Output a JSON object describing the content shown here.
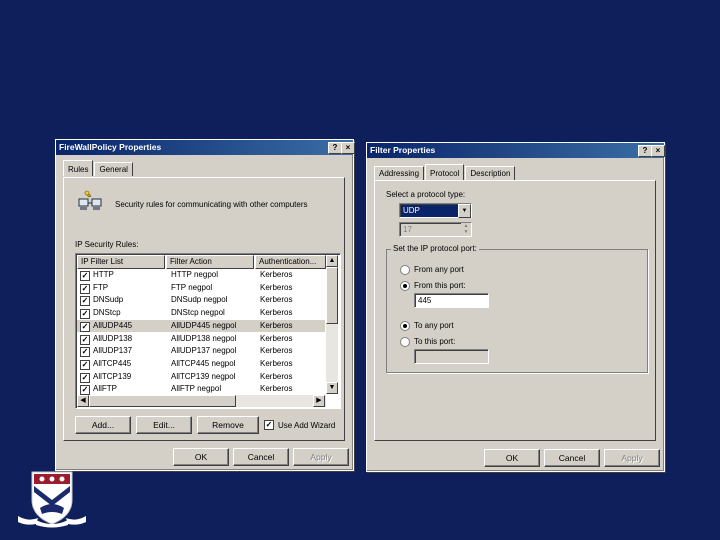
{
  "left_dialog": {
    "title": "FireWallPolicy Properties",
    "help": "?",
    "close": "×",
    "tabs": [
      "Rules",
      "General"
    ],
    "description": "Security rules for communicating with other computers",
    "rules_label": "IP Security Rules:",
    "columns": [
      "IP Filter List",
      "Filter Action",
      "Authentication..."
    ],
    "rows": [
      {
        "checked": true,
        "filter": "HTTP",
        "action": "HTTP negpol",
        "auth": "Kerberos"
      },
      {
        "checked": true,
        "filter": "FTP",
        "action": "FTP negpol",
        "auth": "Kerberos"
      },
      {
        "checked": true,
        "filter": "DNSudp",
        "action": "DNSudp negpol",
        "auth": "Kerberos"
      },
      {
        "checked": true,
        "filter": "DNStcp",
        "action": "DNStcp negpol",
        "auth": "Kerberos"
      },
      {
        "checked": true,
        "filter": "AllUDP445",
        "action": "AllUDP445 negpol",
        "auth": "Kerberos",
        "selected": true
      },
      {
        "checked": true,
        "filter": "AllUDP138",
        "action": "AllUDP138 negpol",
        "auth": "Kerberos"
      },
      {
        "checked": true,
        "filter": "AllUDP137",
        "action": "AllUDP137 negpol",
        "auth": "Kerberos"
      },
      {
        "checked": true,
        "filter": "AllTCP445",
        "action": "AllTCP445 negpol",
        "auth": "Kerberos"
      },
      {
        "checked": true,
        "filter": "AllTCP139",
        "action": "AllTCP139 negpol",
        "auth": "Kerberos"
      },
      {
        "checked": true,
        "filter": "AllFTP",
        "action": "AllFTP negpol",
        "auth": "Kerberos"
      }
    ],
    "buttons": {
      "add": "Add...",
      "edit": "Edit...",
      "remove": "Remove"
    },
    "use_wizard": "Use Add Wizard",
    "footer": {
      "ok": "OK",
      "cancel": "Cancel",
      "apply": "Apply"
    }
  },
  "right_dialog": {
    "title": "Filter Properties",
    "help": "?",
    "close": "×",
    "tabs": [
      "Addressing",
      "Protocol",
      "Description"
    ],
    "protocol_label": "Select a protocol type:",
    "protocol_value": "UDP",
    "protocol_number": "17",
    "port_group": "Set the IP protocol port:",
    "from_any": "From any port",
    "from_this": "From this port:",
    "from_port_value": "445",
    "to_any": "To any port",
    "to_this": "To this port:",
    "to_port_value": "",
    "footer": {
      "ok": "OK",
      "cancel": "Cancel",
      "apply": "Apply"
    }
  }
}
